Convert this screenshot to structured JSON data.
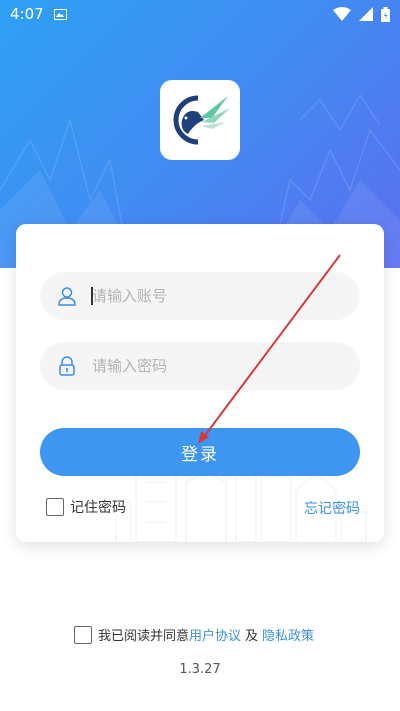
{
  "status_bar": {
    "time": "4:07"
  },
  "login_form": {
    "account_placeholder": "请输入账号",
    "password_placeholder": "请输入密码",
    "login_label": "登录",
    "remember_label": "记住密码",
    "forgot_label": "忘记密码"
  },
  "agreement": {
    "prefix": "我已阅读并同意",
    "user_agreement": "用户协议",
    "conjunction": "及",
    "privacy_policy": "隐私政策"
  },
  "version": "1.3.27",
  "colors": {
    "primary": "#3d96f0",
    "link": "#3d8fe0",
    "annotation_arrow": "#d9383a"
  },
  "icons": {
    "status_image": "image-icon",
    "wifi": "wifi-icon",
    "signal": "signal-icon",
    "battery": "battery-icon",
    "account": "user-icon",
    "password": "lock-icon"
  }
}
